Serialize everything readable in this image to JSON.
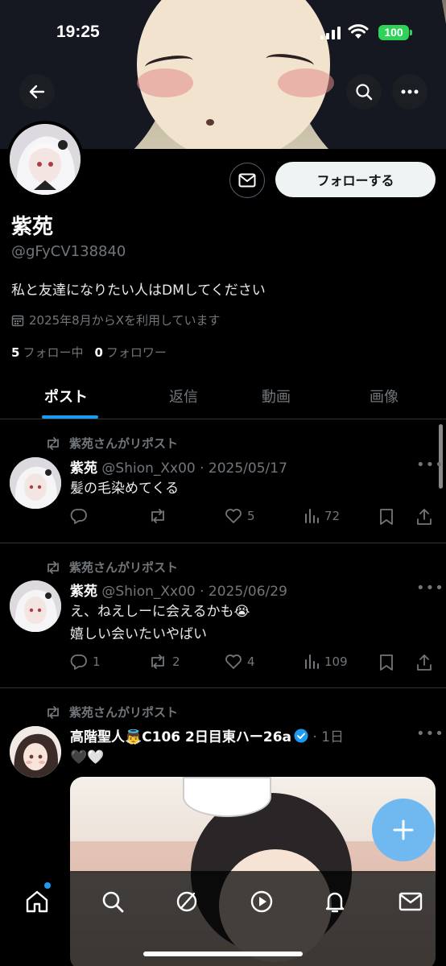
{
  "status_bar": {
    "time": "19:25",
    "battery": "100"
  },
  "profile": {
    "display_name": "紫苑",
    "handle": "@gFyCV138840",
    "bio": "私と友達になりたい人はDMしてください",
    "joined": "2025年8月からXを利用しています",
    "following_count": "5",
    "following_label": "フォロー中",
    "followers_count": "0",
    "followers_label": "フォロワー",
    "follow_button": "フォローする"
  },
  "tabs": [
    {
      "label": "ポスト",
      "active": true
    },
    {
      "label": "返信",
      "active": false
    },
    {
      "label": "動画",
      "active": false
    },
    {
      "label": "画像",
      "active": false
    }
  ],
  "posts": [
    {
      "repost_label": "紫苑さんがリポスト",
      "name": "紫苑",
      "meta": " @Shion_Xx00 · 2025/05/17",
      "text": [
        "髪の毛染めてくる"
      ],
      "replies": "",
      "reposts": "",
      "likes": "5",
      "views": "72"
    },
    {
      "repost_label": "紫苑さんがリポスト",
      "name": "紫苑",
      "meta": " @Shion_Xx00 · 2025/06/29",
      "text": [
        "え、ねえしーに会えるかも😭",
        "嬉しい会いたいやばい"
      ],
      "replies": "1",
      "reposts": "2",
      "likes": "4",
      "views": "109"
    },
    {
      "repost_label": "紫苑さんがリポスト",
      "name": "高階聖人👼C106 2日目東ハー26a",
      "meta": " · 1日",
      "text": [
        "🖤🤍"
      ],
      "verified": true
    }
  ],
  "colors": {
    "accent": "#1d9bf0",
    "background": "#000000",
    "muted": "#71767b"
  }
}
